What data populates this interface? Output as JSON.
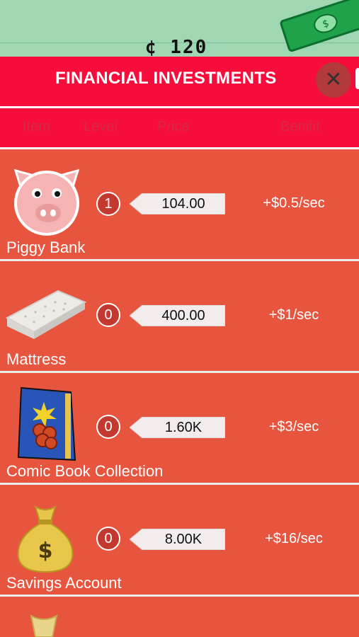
{
  "background": {
    "counter_text": "¢ 120"
  },
  "header": {
    "title": "FINANCIAL INVESTMENTS",
    "close_icon": "close-icon"
  },
  "columns": {
    "item": "Item",
    "level": "Level",
    "price": "Price",
    "benefit": "Benifit"
  },
  "items": [
    {
      "name": "Piggy Bank",
      "level": "1",
      "price": "104.00",
      "benefit": "+$0.5/sec",
      "icon": "piggy-bank-icon"
    },
    {
      "name": "Mattress",
      "level": "0",
      "price": "400.00",
      "benefit": "+$1/sec",
      "icon": "mattress-icon"
    },
    {
      "name": "Comic Book Collection",
      "level": "0",
      "price": "1.60K",
      "benefit": "+$3/sec",
      "icon": "comic-book-icon"
    },
    {
      "name": "Savings Account",
      "level": "0",
      "price": "8.00K",
      "benefit": "+$16/sec",
      "icon": "money-bag-icon"
    }
  ],
  "colors": {
    "header_red": "#f70d3c",
    "row_red": "#e8553f",
    "bg_green": "#9fd6b4"
  }
}
